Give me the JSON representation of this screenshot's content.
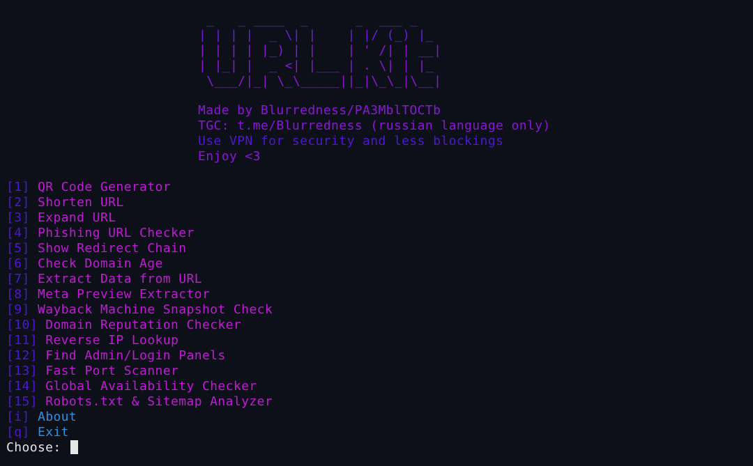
{
  "banner": {
    "lines": [
      " _   _ ____  _      _  ___ _   ",
      "| | | |  _ \\| |    | |/ (_) |_ ",
      "| | | | |_) | |    | ' /| | __|",
      "| |_| |  _ <| |___ | . \\| | |_ ",
      " \\___/|_| \\_\\_____||_|\\_\\_|\\__|"
    ]
  },
  "info": {
    "made_by": "Made by Blurredness/PA3MblTOCTb",
    "tgc": "TGC: t.me/Blurredness (russian language only)",
    "vpn": "Use VPN for security and less blockings",
    "enjoy": "Enjoy <3"
  },
  "menu": [
    {
      "key": "[1]",
      "label": "QR Code Generator"
    },
    {
      "key": "[2]",
      "label": "Shorten URL"
    },
    {
      "key": "[3]",
      "label": "Expand URL"
    },
    {
      "key": "[4]",
      "label": "Phishing URL Checker"
    },
    {
      "key": "[5]",
      "label": "Show Redirect Chain"
    },
    {
      "key": "[6]",
      "label": "Check Domain Age"
    },
    {
      "key": "[7]",
      "label": "Extract Data from URL"
    },
    {
      "key": "[8]",
      "label": "Meta Preview Extractor"
    },
    {
      "key": "[9]",
      "label": "Wayback Machine Snapshot Check"
    },
    {
      "key": "[10]",
      "label": "Domain Reputation Checker"
    },
    {
      "key": "[11]",
      "label": "Reverse IP Lookup"
    },
    {
      "key": "[12]",
      "label": "Find Admin/Login Panels"
    },
    {
      "key": "[13]",
      "label": "Fast Port Scanner"
    },
    {
      "key": "[14]",
      "label": "Global Availability Checker"
    },
    {
      "key": "[15]",
      "label": "Robots.txt & Sitemap Analyzer"
    },
    {
      "key": "[i]",
      "label": "About"
    },
    {
      "key": "[q]",
      "label": "Exit"
    }
  ],
  "prompt": {
    "text": "Choose: "
  },
  "colors": {
    "background": "#0d1019",
    "magenta": "#c21ad6",
    "purple": "#8a17d8",
    "blue": "#4d18cf",
    "cyan": "#2d8fe0",
    "prompt": "#e6e6e6"
  }
}
